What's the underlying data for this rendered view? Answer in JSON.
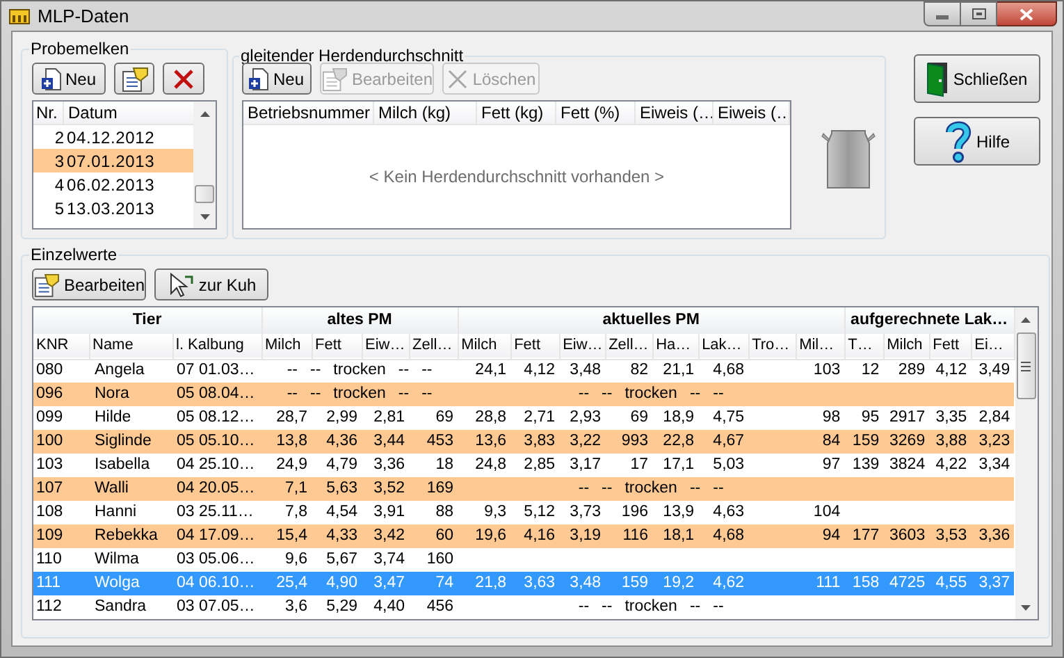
{
  "window": {
    "title": "MLP-Daten"
  },
  "probemelken": {
    "title": "Probemelken",
    "buttons": [
      {
        "kind": "new",
        "label": "Neu"
      },
      {
        "kind": "edit"
      },
      {
        "kind": "delete"
      }
    ],
    "columns": [
      "Nr.",
      "Datum"
    ],
    "rows": [
      {
        "nr": "2",
        "datum": "04.12.2012",
        "selected": false
      },
      {
        "nr": "3",
        "datum": "07.01.2013",
        "selected": true
      },
      {
        "nr": "4",
        "datum": "06.02.2013",
        "selected": false
      },
      {
        "nr": "5",
        "datum": "13.03.2013",
        "selected": false
      }
    ]
  },
  "herdendurchschnitt": {
    "title": "gleitender Herdendurchschnitt",
    "buttons": [
      {
        "kind": "new",
        "label": "Neu",
        "disabled": false
      },
      {
        "kind": "edit",
        "label": "Bearbeiten",
        "disabled": true
      },
      {
        "kind": "delete",
        "label": "Löschen",
        "disabled": true
      }
    ],
    "columns": [
      "Betriebsnummer",
      "Milch (kg)",
      "Fett (kg)",
      "Fett (%)",
      "Eiweis (…",
      "Eiweis (…"
    ],
    "empty_message": "< Kein Herdendurchschnitt vorhanden >"
  },
  "side_buttons": [
    {
      "kind": "close",
      "label": "Schließen"
    },
    {
      "kind": "help",
      "label": "Hilfe"
    }
  ],
  "einzelwerte": {
    "title": "Einzelwerte",
    "buttons": [
      {
        "kind": "edit",
        "label": "Bearbeiten"
      },
      {
        "kind": "goto",
        "label": "zur Kuh"
      }
    ],
    "column_groups": [
      {
        "label": "Tier",
        "columns": [
          "KNR",
          "Name",
          "l. Kalbung"
        ]
      },
      {
        "label": "altes PM",
        "columns": [
          "Milch",
          "Fett",
          "Eiw…",
          "Zell…"
        ]
      },
      {
        "label": "aktuelles PM",
        "columns": [
          "Milch",
          "Fett",
          "Eiw…",
          "Zell…",
          "Ha…",
          "Lak…",
          "Tro…",
          "Mil…"
        ]
      },
      {
        "label": "aufgerechnete Lak…",
        "columns": [
          "T…",
          "Milch",
          "Fett",
          "Ei…"
        ]
      }
    ],
    "rows": [
      {
        "knr": "080",
        "name": "Angela",
        "kalbung": "07 01.03…",
        "highlighted": false,
        "selected": false,
        "altes_pm": {
          "kind": "dry",
          "texts": [
            "--",
            "--",
            "trocken",
            "--",
            "--"
          ]
        },
        "aktuelles_pm": {
          "kind": "values",
          "values": [
            "24,1",
            "4,12",
            "3,48",
            "82",
            "21,1",
            "4,68",
            "103"
          ]
        },
        "aufgerechnet": {
          "kind": "values",
          "values": [
            "12",
            "289",
            "4,12",
            "3,49"
          ]
        }
      },
      {
        "knr": "096",
        "name": "Nora",
        "kalbung": "05 08.04…",
        "highlighted": true,
        "selected": false,
        "altes_pm": {
          "kind": "dry",
          "texts": [
            "--",
            "--",
            "trocken",
            "--",
            "--"
          ]
        },
        "aktuelles_pm": {
          "kind": "dry",
          "texts": [
            "--",
            "--",
            "trocken",
            "--",
            "--"
          ]
        },
        "aufgerechnet": {
          "kind": "empty"
        }
      },
      {
        "knr": "099",
        "name": "Hilde",
        "kalbung": "05 08.12…",
        "highlighted": false,
        "selected": false,
        "altes_pm": {
          "kind": "values",
          "values": [
            "28,7",
            "2,99",
            "2,81",
            "69"
          ]
        },
        "aktuelles_pm": {
          "kind": "values",
          "values": [
            "28,8",
            "2,71",
            "2,93",
            "69",
            "18,9",
            "4,75",
            "98"
          ]
        },
        "aufgerechnet": {
          "kind": "values",
          "values": [
            "95",
            "2917",
            "3,35",
            "2,84"
          ]
        }
      },
      {
        "knr": "100",
        "name": "Siglinde",
        "kalbung": "05 05.10…",
        "highlighted": true,
        "selected": false,
        "altes_pm": {
          "kind": "values",
          "values": [
            "13,8",
            "4,36",
            "3,44",
            "453"
          ]
        },
        "aktuelles_pm": {
          "kind": "values",
          "values": [
            "13,6",
            "3,83",
            "3,22",
            "993",
            "22,8",
            "4,67",
            "84"
          ]
        },
        "aufgerechnet": {
          "kind": "values",
          "values": [
            "159",
            "3269",
            "3,88",
            "3,23"
          ]
        }
      },
      {
        "knr": "103",
        "name": "Isabella",
        "kalbung": "04 25.10…",
        "highlighted": false,
        "selected": false,
        "altes_pm": {
          "kind": "values",
          "values": [
            "24,9",
            "4,79",
            "3,36",
            "18"
          ]
        },
        "aktuelles_pm": {
          "kind": "values",
          "values": [
            "24,8",
            "2,85",
            "3,17",
            "17",
            "17,1",
            "5,03",
            "97"
          ]
        },
        "aufgerechnet": {
          "kind": "values",
          "values": [
            "139",
            "3824",
            "4,22",
            "3,34"
          ]
        }
      },
      {
        "knr": "107",
        "name": "Walli",
        "kalbung": "04 20.05…",
        "highlighted": true,
        "selected": false,
        "altes_pm": {
          "kind": "values",
          "values": [
            "7,1",
            "5,63",
            "3,52",
            "169"
          ]
        },
        "aktuelles_pm": {
          "kind": "dry",
          "texts": [
            "--",
            "--",
            "trocken",
            "--",
            "--"
          ]
        },
        "aufgerechnet": {
          "kind": "empty"
        }
      },
      {
        "knr": "108",
        "name": "Hanni",
        "kalbung": "03 25.11…",
        "highlighted": false,
        "selected": false,
        "altes_pm": {
          "kind": "values",
          "values": [
            "7,8",
            "4,54",
            "3,91",
            "88"
          ]
        },
        "aktuelles_pm": {
          "kind": "values",
          "values": [
            "9,3",
            "5,12",
            "3,73",
            "196",
            "13,9",
            "4,63",
            "104"
          ]
        },
        "aufgerechnet": {
          "kind": "empty"
        }
      },
      {
        "knr": "109",
        "name": "Rebekka",
        "kalbung": "04 17.09…",
        "highlighted": true,
        "selected": false,
        "altes_pm": {
          "kind": "values",
          "values": [
            "15,4",
            "4,33",
            "3,42",
            "60"
          ]
        },
        "aktuelles_pm": {
          "kind": "values",
          "values": [
            "19,6",
            "4,16",
            "3,19",
            "116",
            "18,1",
            "4,68",
            "94"
          ]
        },
        "aufgerechnet": {
          "kind": "values",
          "values": [
            "177",
            "3603",
            "3,53",
            "3,36"
          ]
        }
      },
      {
        "knr": "110",
        "name": "Wilma",
        "kalbung": "03 05.06…",
        "highlighted": false,
        "selected": false,
        "altes_pm": {
          "kind": "values",
          "values": [
            "9,6",
            "5,67",
            "3,74",
            "160"
          ]
        },
        "aktuelles_pm": {
          "kind": "empty"
        },
        "aufgerechnet": {
          "kind": "empty"
        }
      },
      {
        "knr": "111",
        "name": "Wolga",
        "kalbung": "04 06.10…",
        "highlighted": false,
        "selected": true,
        "altes_pm": {
          "kind": "values",
          "values": [
            "25,4",
            "4,90",
            "3,47",
            "74"
          ]
        },
        "aktuelles_pm": {
          "kind": "values",
          "values": [
            "21,8",
            "3,63",
            "3,48",
            "159",
            "19,2",
            "4,62",
            "111"
          ]
        },
        "aufgerechnet": {
          "kind": "values",
          "values": [
            "158",
            "4725",
            "4,55",
            "3,37"
          ]
        }
      },
      {
        "knr": "112",
        "name": "Sandra",
        "kalbung": "03 07.05…",
        "highlighted": false,
        "selected": false,
        "altes_pm": {
          "kind": "values",
          "values": [
            "3,6",
            "5,29",
            "4,40",
            "456"
          ]
        },
        "aktuelles_pm": {
          "kind": "dry",
          "texts": [
            "--",
            "--",
            "trocken",
            "--",
            "--"
          ]
        },
        "aufgerechnet": {
          "kind": "empty"
        }
      }
    ]
  }
}
